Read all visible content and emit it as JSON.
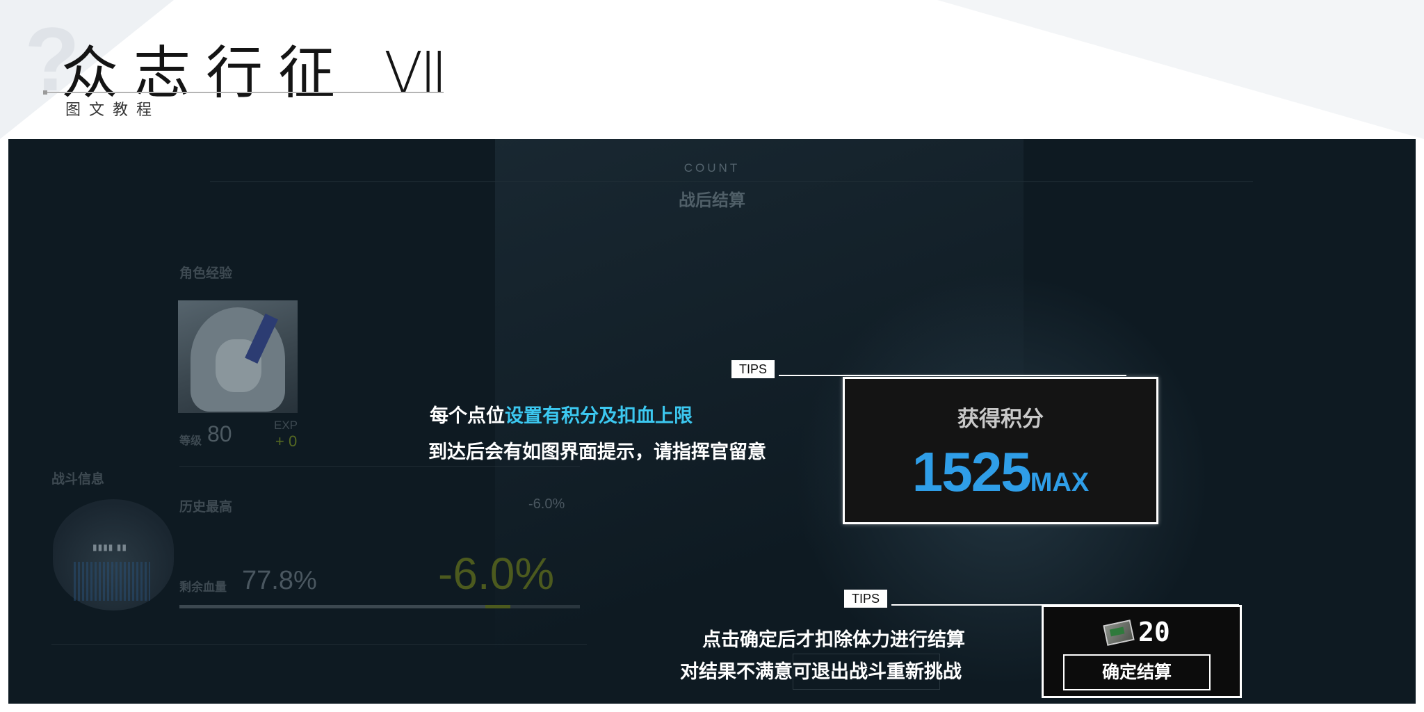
{
  "header": {
    "title": "众志行征 Ⅶ",
    "subtitle": "图文教程"
  },
  "screen": {
    "count_label": "COUNT",
    "settle_title": "战后结算",
    "character": {
      "section_label": "角色经验",
      "level_label": "等级",
      "level_value": "80",
      "exp_label": "EXP",
      "exp_value": "+ 0"
    },
    "battle": {
      "section_label": "战斗信息",
      "history_label": "历史最高",
      "history_value": "-6.0%",
      "hp_label": "剩余血量",
      "hp_value": "77.8%",
      "hp_change": "-6.0%",
      "hp_fraction": 0.778
    }
  },
  "tips": [
    {
      "tag": "TIPS",
      "line1_prefix": "每个点位",
      "line1_highlight": "设置有积分及扣血上限",
      "line2": "到达后会有如图界面提示，请指挥官留意"
    },
    {
      "tag": "TIPS",
      "line1": "点击确定后才扣除体力进行结算",
      "line2": "对结果不满意可退出战斗重新挑战"
    }
  ],
  "score_box": {
    "label": "获得积分",
    "value": "1525",
    "max_label": "MAX"
  },
  "confirm_box": {
    "icon": "stamina-icon",
    "stamina_cost": "20",
    "button_label": "确定结算"
  },
  "colors": {
    "highlight": "#3cc8f0",
    "score": "#2f9ee8",
    "panel_bg": "#0e1a22"
  }
}
